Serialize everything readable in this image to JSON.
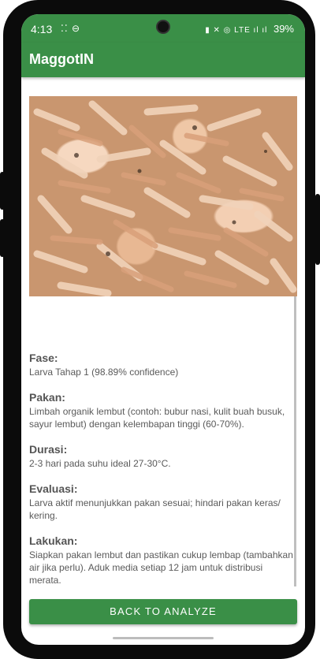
{
  "status_bar": {
    "time": "4:13",
    "misc": "⁚⁚ ⊖",
    "icons": "▮ ✕ ◎ LTE ıl ıl",
    "battery": "39%"
  },
  "app_bar": {
    "title": "MaggotIN"
  },
  "result": {
    "image_desc": "maggot-larvae-photo",
    "sections": [
      {
        "label": "Fase:",
        "text": "Larva Tahap 1 (98.89% confidence)"
      },
      {
        "label": "Pakan:",
        "text": "Limbah organik lembut (contoh: bubur nasi, kulit buah busuk, sayur lembut) dengan kelembapan tinggi (60-70%)."
      },
      {
        "label": "Durasi:",
        "text": "2-3 hari pada suhu ideal 27-30°C."
      },
      {
        "label": "Evaluasi:",
        "text": "Larva aktif menunjukkan pakan sesuai; hindari pakan keras/ kering."
      },
      {
        "label": "Lakukan:",
        "text": "Siapkan pakan lembut dan pastikan cukup lembap (tambahkan air jika perlu). Aduk media setiap 12 jam untuk distribusi merata."
      }
    ]
  },
  "actions": {
    "back_label": "BACK TO ANALYZE"
  },
  "colors": {
    "primary": "#3a8f47"
  }
}
